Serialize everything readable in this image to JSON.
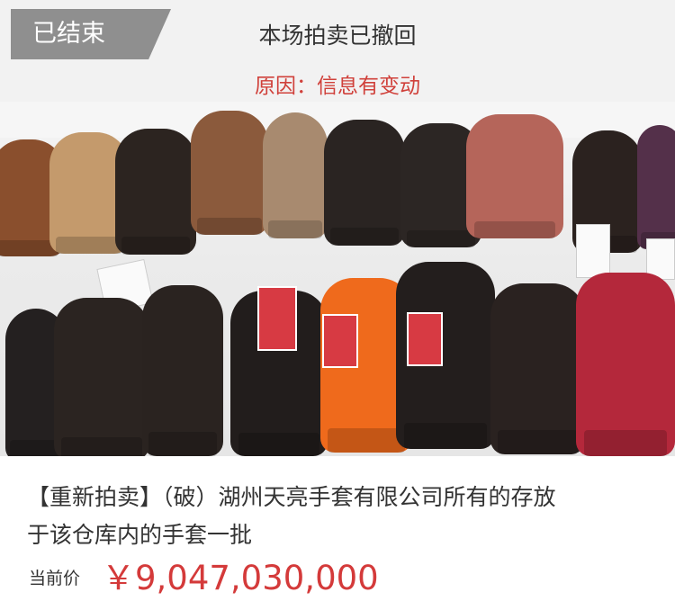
{
  "notice": {
    "status_tag": "已结束",
    "title": "本场拍卖已撤回",
    "reason": "原因：信息有变动"
  },
  "gallery": {
    "page_count": 4,
    "active_index": 0,
    "active_color": "#f06a1f"
  },
  "product": {
    "title": "【重新拍卖】（破）湖州天亮手套有限公司所有的存放于该仓库内的手套一批",
    "price_label": "当前价",
    "price": "￥9,047,030,000"
  },
  "colors": {
    "accent": "#d43a3a",
    "status_tag_bg": "#8f8f8f"
  }
}
